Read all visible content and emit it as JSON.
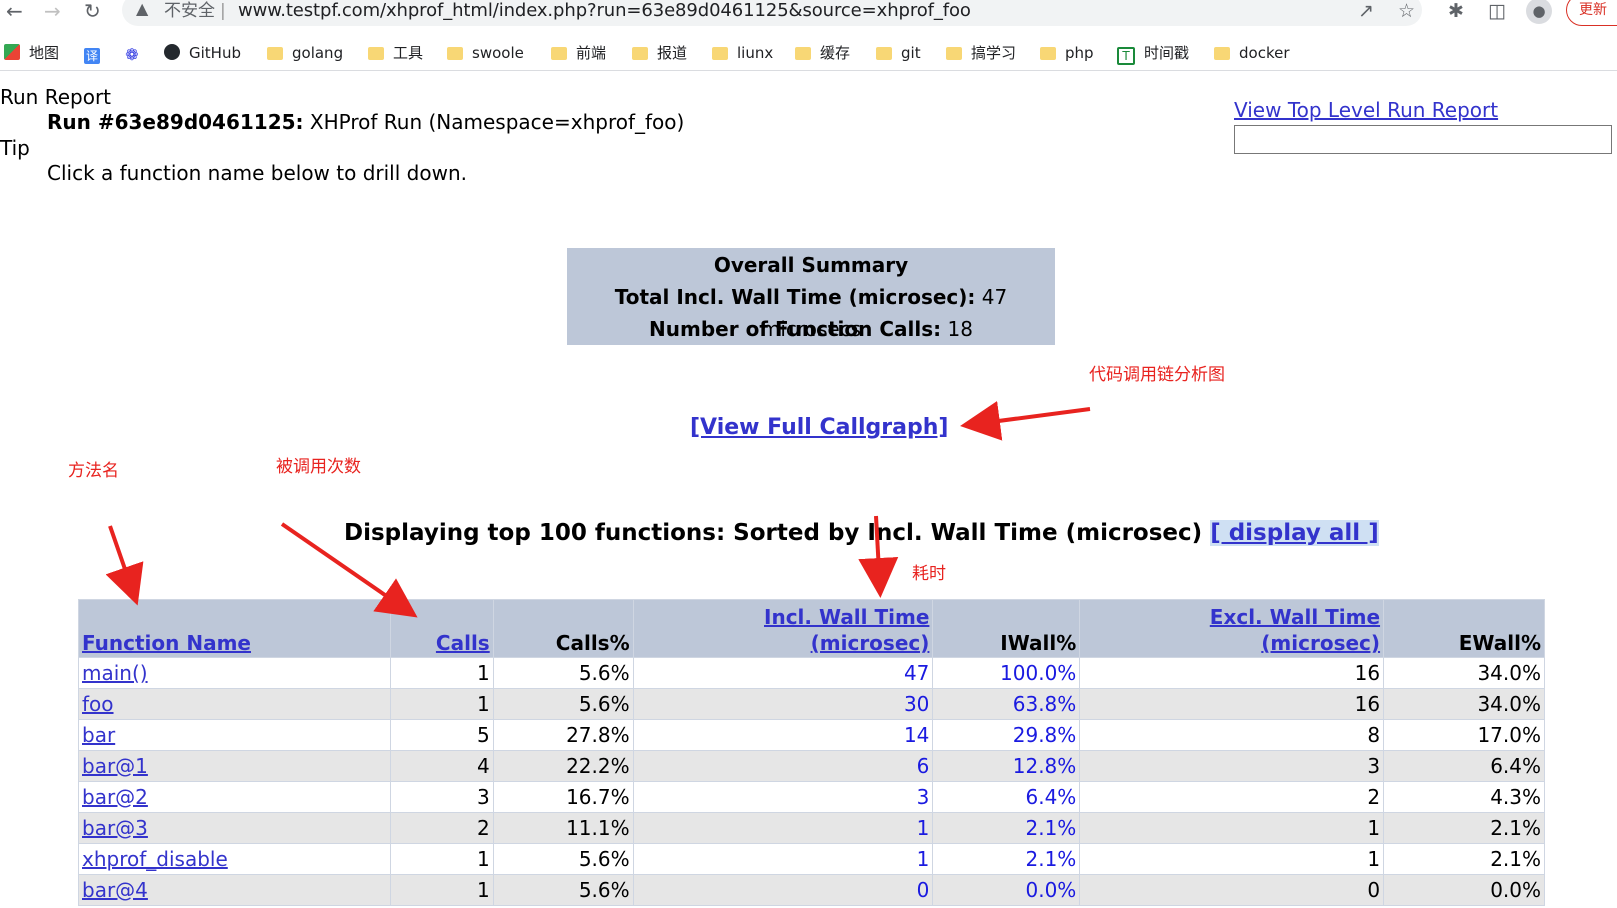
{
  "browser": {
    "insecure_label": "不安全",
    "separator": "|",
    "url": "www.testpf.com/xhprof_html/index.php?run=63e89d0461125&source=xhprof_foo",
    "update_label": "更新"
  },
  "bookmarks": [
    {
      "label": "地图",
      "icon": "maps-icon"
    },
    {
      "label": "",
      "icon": "translate-icon",
      "glyph": "译"
    },
    {
      "label": "",
      "icon": "baidu-paw-icon"
    },
    {
      "label": "GitHub",
      "icon": "github-icon"
    },
    {
      "label": "golang",
      "icon": "folder-icon"
    },
    {
      "label": "工具",
      "icon": "folder-icon"
    },
    {
      "label": "swoole",
      "icon": "folder-icon"
    },
    {
      "label": "前端",
      "icon": "folder-icon"
    },
    {
      "label": "报道",
      "icon": "folder-icon"
    },
    {
      "label": "liunx",
      "icon": "folder-icon"
    },
    {
      "label": "缓存",
      "icon": "folder-icon"
    },
    {
      "label": "git",
      "icon": "folder-icon"
    },
    {
      "label": "搞学习",
      "icon": "folder-icon"
    },
    {
      "label": "php",
      "icon": "folder-icon"
    },
    {
      "label": "时间戳",
      "icon": "timestamp-icon"
    },
    {
      "label": "docker",
      "icon": "folder-icon"
    }
  ],
  "report": {
    "heading": "Run Report",
    "run_id_label": "Run #63e89d0461125:",
    "run_desc": "XHProf Run (Namespace=xhprof_foo)",
    "tip_heading": "Tip",
    "tip_text": "Click a function name below to drill down.",
    "top_level_link": "View Top Level Run Report"
  },
  "summary": {
    "title": "Overall Summary",
    "wall_label": "Total Incl. Wall Time (microsec):",
    "wall_value": "47 microsecs",
    "calls_label": "Number of Function Calls:",
    "calls_value": "18"
  },
  "callgraph_link": "[View Full Callgraph]",
  "sort_line": {
    "text": "Displaying top 100 functions: Sorted by Incl. Wall Time (microsec)",
    "display_all": "[ display all ]"
  },
  "annotations": {
    "callgraph": "代码调用链分析图",
    "function_name": "方法名",
    "calls": "被调用次数",
    "time": "耗时"
  },
  "table": {
    "headers": {
      "fn": "Function Name",
      "calls": "Calls",
      "calls_pct": "Calls%",
      "incl_wall_1": "Incl. Wall Time",
      "incl_wall_2": "(microsec)",
      "iwall_pct": "IWall%",
      "excl_wall_1": "Excl. Wall Time",
      "excl_wall_2": "(microsec)",
      "ewall_pct": "EWall%"
    },
    "rows": [
      {
        "fn": "main()",
        "calls": "1",
        "calls_pct": "5.6%",
        "incl": "47",
        "iwall": "100.0%",
        "excl": "16",
        "ewall": "34.0%"
      },
      {
        "fn": "foo",
        "calls": "1",
        "calls_pct": "5.6%",
        "incl": "30",
        "iwall": "63.8%",
        "excl": "16",
        "ewall": "34.0%"
      },
      {
        "fn": "bar",
        "calls": "5",
        "calls_pct": "27.8%",
        "incl": "14",
        "iwall": "29.8%",
        "excl": "8",
        "ewall": "17.0%"
      },
      {
        "fn": "bar@1",
        "calls": "4",
        "calls_pct": "22.2%",
        "incl": "6",
        "iwall": "12.8%",
        "excl": "3",
        "ewall": "6.4%"
      },
      {
        "fn": "bar@2",
        "calls": "3",
        "calls_pct": "16.7%",
        "incl": "3",
        "iwall": "6.4%",
        "excl": "2",
        "ewall": "4.3%"
      },
      {
        "fn": "bar@3",
        "calls": "2",
        "calls_pct": "11.1%",
        "incl": "1",
        "iwall": "2.1%",
        "excl": "1",
        "ewall": "2.1%"
      },
      {
        "fn": "xhprof_disable",
        "calls": "1",
        "calls_pct": "5.6%",
        "incl": "1",
        "iwall": "2.1%",
        "excl": "1",
        "ewall": "2.1%"
      },
      {
        "fn": "bar@4",
        "calls": "1",
        "calls_pct": "5.6%",
        "incl": "0",
        "iwall": "0.0%",
        "excl": "0",
        "ewall": "0.0%"
      }
    ]
  },
  "colors": {
    "header_bg": "#bdc7d8",
    "link": "#3333cc",
    "annotation": "#e8231f",
    "alt_row": "#e6e6e6"
  }
}
